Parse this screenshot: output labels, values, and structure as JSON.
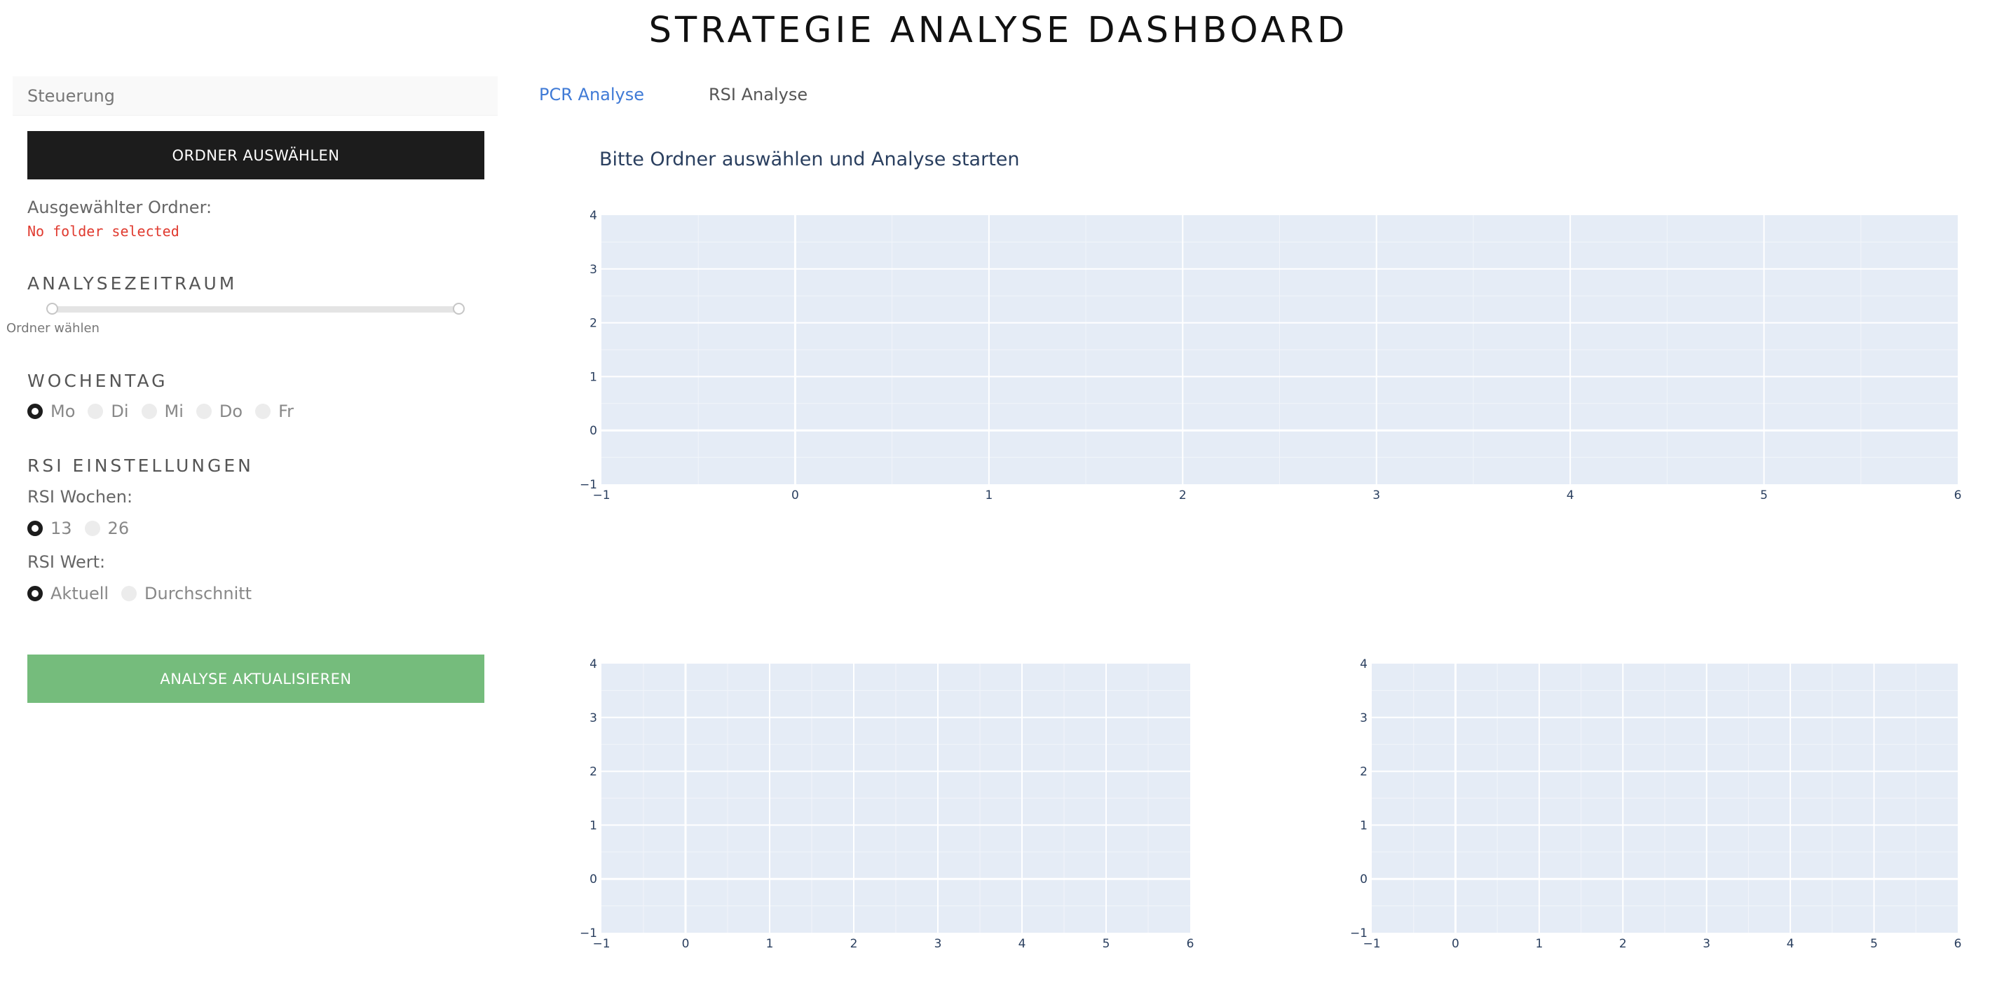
{
  "header": {
    "title": "STRATEGIE ANALYSE DASHBOARD"
  },
  "sidebar": {
    "panel_title": "Steuerung",
    "select_folder_button": "ORDNER AUSWÄHLEN",
    "selected_folder_label": "Ausgewählter Ordner:",
    "selected_folder_value": "No folder selected",
    "period": {
      "heading": "ANALYSEZEITRAUM",
      "slider_note": "Ordner wählen"
    },
    "weekday": {
      "heading": "WOCHENTAG",
      "options": [
        "Mo",
        "Di",
        "Mi",
        "Do",
        "Fr"
      ],
      "selected": "Mo"
    },
    "rsi": {
      "heading": "RSI EINSTELLUNGEN",
      "weeks_label": "RSI Wochen:",
      "weeks_options": [
        "13",
        "26"
      ],
      "weeks_selected": "13",
      "value_label": "RSI Wert:",
      "value_options": [
        "Aktuell",
        "Durchschnitt"
      ],
      "value_selected": "Aktuell"
    },
    "update_button": "ANALYSE AKTUALISIEREN"
  },
  "tabs": [
    {
      "label": "PCR Analyse",
      "active": true
    },
    {
      "label": "RSI Analyse",
      "active": false
    }
  ],
  "main": {
    "message": "Bitte Ordner auswählen und Analyse starten"
  },
  "colors": {
    "accent": "#3f7ad6",
    "dark_button": "#1c1c1c",
    "green_button": "#75bc7c",
    "plot_background": "#e5ecf6",
    "error": "#e03a2f"
  },
  "chart_data": [
    {
      "type": "scatter",
      "series": [],
      "xlim": [
        -1,
        6
      ],
      "ylim": [
        -1,
        4
      ],
      "xticks": [
        "−1",
        "0",
        "1",
        "2",
        "3",
        "4",
        "5",
        "6"
      ],
      "yticks": [
        "−1",
        "0",
        "1",
        "2",
        "3",
        "4"
      ],
      "grid": true
    },
    {
      "type": "scatter",
      "series": [],
      "xlim": [
        -1,
        6
      ],
      "ylim": [
        -1,
        4
      ],
      "xticks": [
        "−1",
        "0",
        "1",
        "2",
        "3",
        "4",
        "5",
        "6"
      ],
      "yticks": [
        "−1",
        "0",
        "1",
        "2",
        "3",
        "4"
      ],
      "grid": true
    },
    {
      "type": "scatter",
      "series": [],
      "xlim": [
        -1,
        6
      ],
      "ylim": [
        -1,
        4
      ],
      "xticks": [
        "−1",
        "0",
        "1",
        "2",
        "3",
        "4",
        "5",
        "6"
      ],
      "yticks": [
        "−1",
        "0",
        "1",
        "2",
        "3",
        "4"
      ],
      "grid": true
    }
  ]
}
